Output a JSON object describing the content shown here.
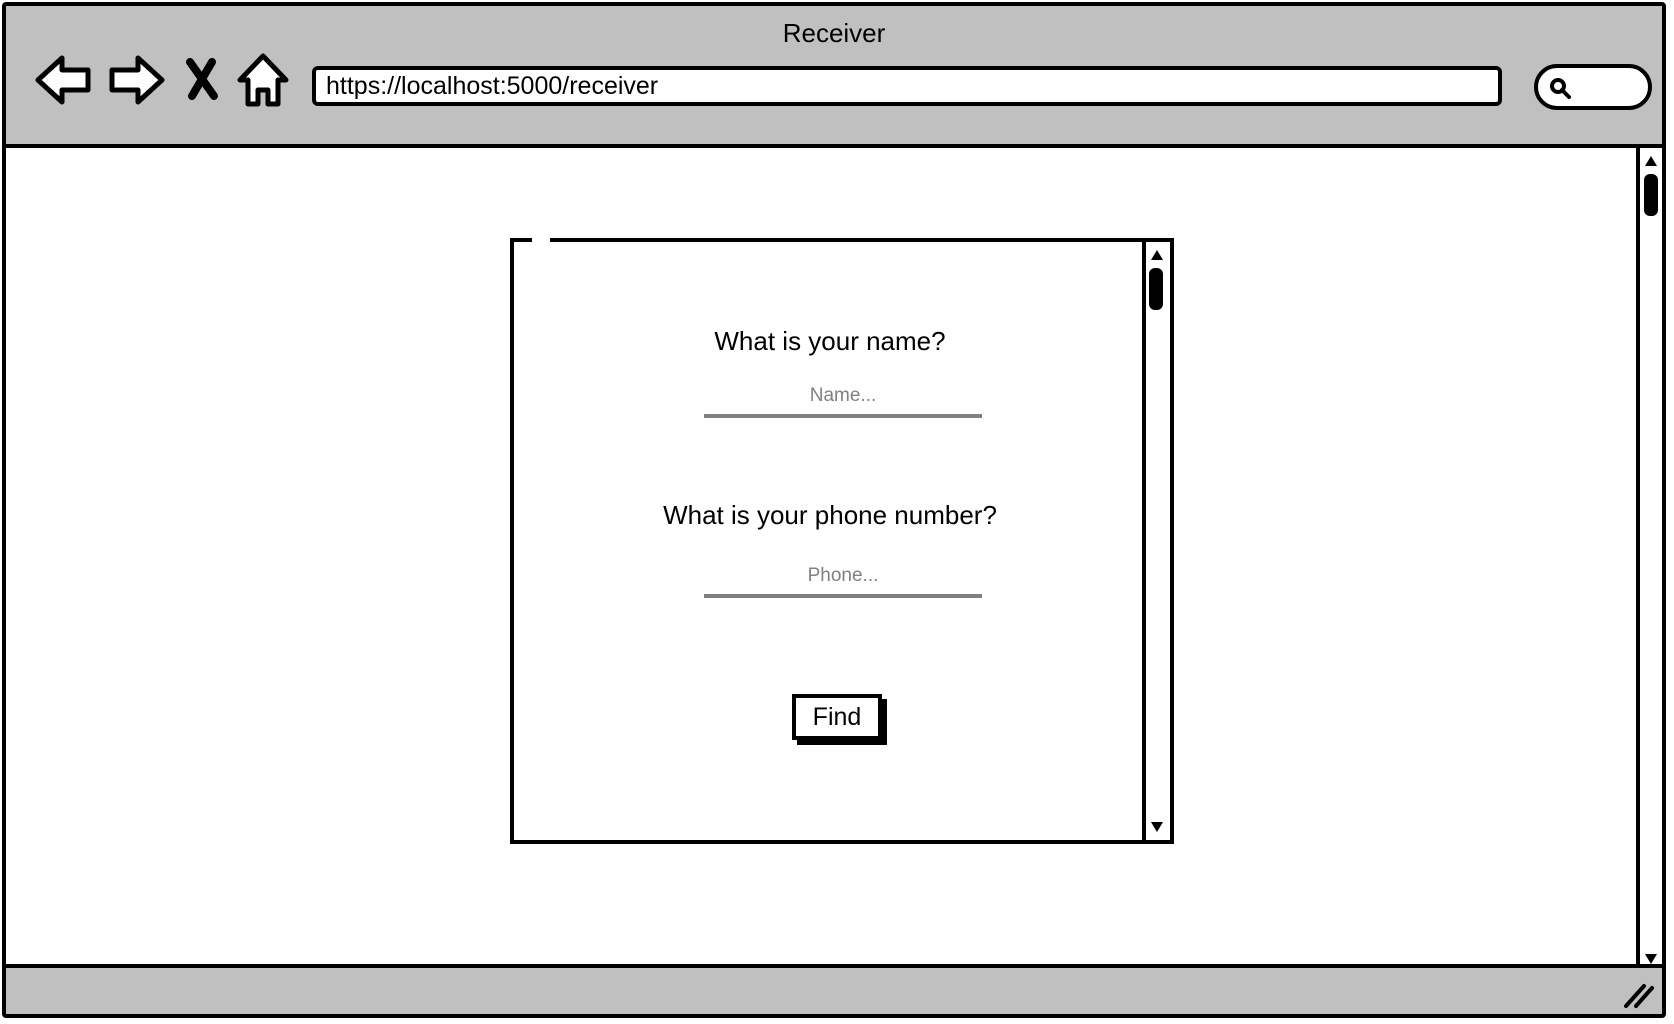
{
  "window": {
    "title": "Receiver"
  },
  "toolbar": {
    "back_icon": "back-arrow-icon",
    "forward_icon": "forward-arrow-icon",
    "stop_icon": "close-x-icon",
    "home_icon": "home-icon",
    "search_icon": "search-icon"
  },
  "address_bar": {
    "url": "https://localhost:5000/receiver"
  },
  "form": {
    "name_question": "What is your name?",
    "name_placeholder": "Name...",
    "phone_question": "What is your phone number?",
    "phone_placeholder": "Phone...",
    "find_label": "Find"
  },
  "colors": {
    "chrome": "#c0c0c0",
    "border": "#000000",
    "field_underline": "#808080"
  }
}
